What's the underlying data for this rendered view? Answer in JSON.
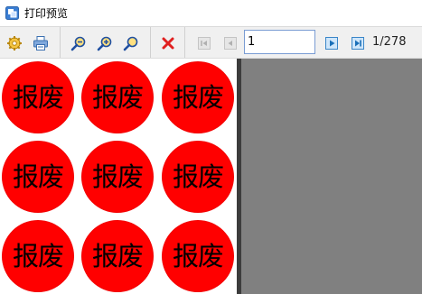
{
  "window": {
    "title": "打印预览"
  },
  "toolbar": {
    "buttons": [
      {
        "name": "settings",
        "icon": "gear-icon"
      },
      {
        "name": "print",
        "icon": "printer-icon"
      },
      {
        "name": "zoom-fit",
        "icon": "zoom-icon"
      },
      {
        "name": "zoom-in",
        "icon": "zoom-in-icon"
      },
      {
        "name": "zoom-out",
        "icon": "zoom-out-icon"
      },
      {
        "name": "close",
        "icon": "close-icon"
      },
      {
        "name": "first-page",
        "icon": "first-page-icon",
        "enabled": false
      },
      {
        "name": "prev-page",
        "icon": "prev-page-icon",
        "enabled": false
      },
      {
        "name": "next-page",
        "icon": "next-page-icon",
        "enabled": true
      },
      {
        "name": "last-page",
        "icon": "last-page-icon",
        "enabled": true
      }
    ],
    "page_input_value": "1",
    "page_count": "1/278"
  },
  "preview": {
    "stamp_text": "报废",
    "stamp_color": "#ff0000",
    "background_color": "#808080",
    "stamp_rows": 3,
    "stamp_cols": 3
  }
}
